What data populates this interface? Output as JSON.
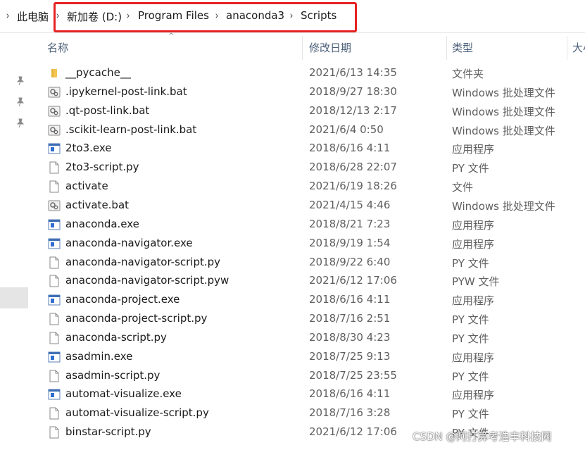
{
  "breadcrumb": {
    "root": "此电脑",
    "items": [
      "新加卷 (D:)",
      "Program Files",
      "anaconda3",
      "Scripts"
    ],
    "separator": "›"
  },
  "highlight_color": "#e52222",
  "columns": [
    "名称",
    "修改日期",
    "类型",
    "大小"
  ],
  "files": [
    {
      "name": "__pycache__",
      "date": "2021/6/13 14:35",
      "type": "文件夹",
      "icon": "folder-icon"
    },
    {
      "name": ".ipykernel-post-link.bat",
      "date": "2018/9/27 18:30",
      "type": "Windows 批处理文件",
      "icon": "batch-file-icon"
    },
    {
      "name": ".qt-post-link.bat",
      "date": "2018/12/13 2:17",
      "type": "Windows 批处理文件",
      "icon": "batch-file-icon"
    },
    {
      "name": ".scikit-learn-post-link.bat",
      "date": "2021/6/4 0:50",
      "type": "Windows 批处理文件",
      "icon": "batch-file-icon"
    },
    {
      "name": "2to3.exe",
      "date": "2018/6/16 4:11",
      "type": "应用程序",
      "icon": "exe-file-icon"
    },
    {
      "name": "2to3-script.py",
      "date": "2018/6/28 22:07",
      "type": "PY 文件",
      "icon": "blank-file-icon"
    },
    {
      "name": "activate",
      "date": "2021/6/19 18:26",
      "type": "文件",
      "icon": "blank-file-icon"
    },
    {
      "name": "activate.bat",
      "date": "2021/4/15 4:46",
      "type": "Windows 批处理文件",
      "icon": "batch-file-icon"
    },
    {
      "name": "anaconda.exe",
      "date": "2018/8/21 7:23",
      "type": "应用程序",
      "icon": "exe-file-icon"
    },
    {
      "name": "anaconda-navigator.exe",
      "date": "2018/9/19 1:54",
      "type": "应用程序",
      "icon": "exe-file-icon"
    },
    {
      "name": "anaconda-navigator-script.py",
      "date": "2018/9/22 6:40",
      "type": "PY 文件",
      "icon": "blank-file-icon"
    },
    {
      "name": "anaconda-navigator-script.pyw",
      "date": "2021/6/12 17:06",
      "type": "PYW 文件",
      "icon": "blank-file-icon"
    },
    {
      "name": "anaconda-project.exe",
      "date": "2018/6/16 4:11",
      "type": "应用程序",
      "icon": "exe-file-icon"
    },
    {
      "name": "anaconda-project-script.py",
      "date": "2018/7/16 2:51",
      "type": "PY 文件",
      "icon": "blank-file-icon"
    },
    {
      "name": "anaconda-script.py",
      "date": "2018/8/30 4:23",
      "type": "PY 文件",
      "icon": "blank-file-icon"
    },
    {
      "name": "asadmin.exe",
      "date": "2018/7/25 9:13",
      "type": "应用程序",
      "icon": "exe-file-icon"
    },
    {
      "name": "asadmin-script.py",
      "date": "2018/7/25 23:55",
      "type": "PY 文件",
      "icon": "blank-file-icon"
    },
    {
      "name": "automat-visualize.exe",
      "date": "2018/6/16 4:11",
      "type": "应用程序",
      "icon": "exe-file-icon"
    },
    {
      "name": "automat-visualize-script.py",
      "date": "2018/7/16 3:28",
      "type": "PY 文件",
      "icon": "blank-file-icon"
    },
    {
      "name": "binstar-script.py",
      "date": "2021/6/12 17:06",
      "type": "PY 文件",
      "icon": "blank-file-icon"
    }
  ],
  "watermark": "CSDN @阿打算考浩丰科技网"
}
